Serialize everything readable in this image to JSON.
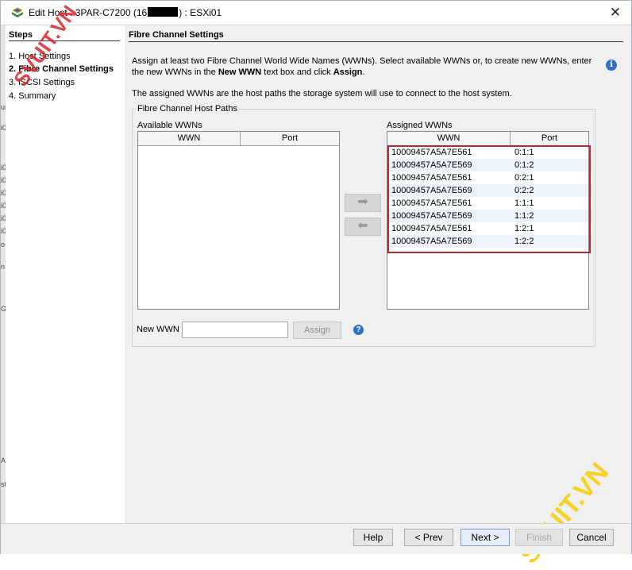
{
  "window": {
    "title_prefix": "Edit Host : 3PAR-C7200 (16",
    "title_suffix": ") : ESXi01",
    "close_glyph": "✕"
  },
  "left_fragments": [
    "un",
    "i0",
    "i0",
    "i0",
    "i0",
    "i0",
    "i0",
    "i0",
    "o",
    "n",
    "G",
    "Al",
    "st"
  ],
  "steps": {
    "title": "Steps",
    "items": [
      {
        "label": "1. Host Settings",
        "active": false
      },
      {
        "label": "2. Fibre Channel Settings",
        "active": true
      },
      {
        "label": "3. iSCSI Settings",
        "active": false
      },
      {
        "label": "4. Summary",
        "active": false
      }
    ]
  },
  "main": {
    "title": "Fibre Channel Settings",
    "instruction_part1": "Assign at least two Fibre Channel World Wide Names (WWNs). Select available WWNs or, to create new WWNs, enter the new WWNs in the ",
    "instruction_bold1": "New WWN",
    "instruction_part2": " text box and click ",
    "instruction_bold2": "Assign",
    "instruction_part3": ".",
    "instruction_paths": "The assigned WWNs are the host paths the storage system will use to connect to the host system.",
    "info_glyph": "i",
    "group_title": "Fibre Channel Host Paths",
    "available": {
      "label": "Available WWNs",
      "columns": [
        "WWN",
        "Port"
      ],
      "rows": []
    },
    "assigned": {
      "label": "Assigned WWNs",
      "columns": [
        "WWN",
        "Port"
      ],
      "rows": [
        {
          "wwn": "10009457A5A7E561",
          "port": "0:1:1"
        },
        {
          "wwn": "10009457A5A7E569",
          "port": "0:1:2"
        },
        {
          "wwn": "10009457A5A7E561",
          "port": "0:2:1"
        },
        {
          "wwn": "10009457A5A7E569",
          "port": "0:2:2"
        },
        {
          "wwn": "10009457A5A7E561",
          "port": "1:1:1"
        },
        {
          "wwn": "10009457A5A7E569",
          "port": "1:1:2"
        },
        {
          "wwn": "10009457A5A7E561",
          "port": "1:2:1"
        },
        {
          "wwn": "10009457A5A7E569",
          "port": "1:2:2"
        }
      ]
    },
    "move_right_glyph": "➡",
    "move_left_glyph": "⬅",
    "new_wwn_label": "New WWN",
    "new_wwn_value": "",
    "assign_label": "Assign",
    "help_glyph": "?"
  },
  "watermark": {
    "text": "SVUIT.VN"
  },
  "footer": {
    "help": "Help",
    "prev": "< Prev",
    "next": "Next >",
    "finish": "Finish",
    "cancel": "Cancel"
  },
  "colors": {
    "highlight": "#c0262c",
    "watermark_red": "#d9262b",
    "watermark_yellow": "#f5d11c",
    "info_blue": "#2e73c7"
  }
}
